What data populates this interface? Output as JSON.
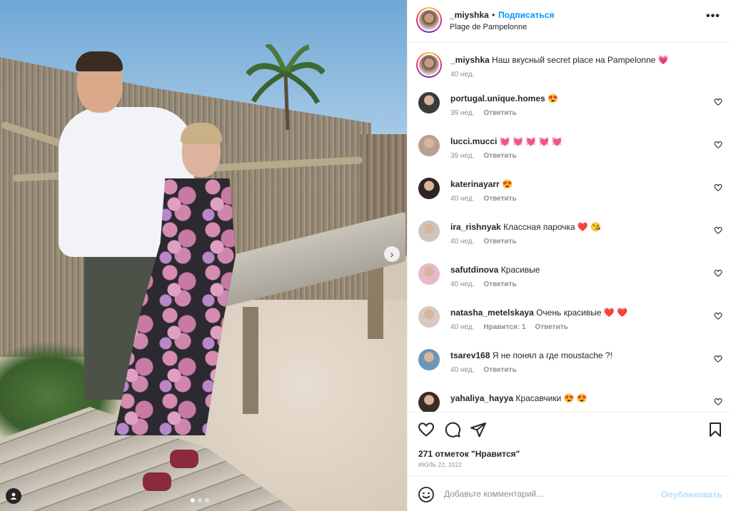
{
  "post": {
    "username": "_miyshka",
    "separator": "•",
    "follow_label": "Подписаться",
    "location": "Plage de Pampelonne",
    "more_label": "•••",
    "caption_text": "Наш вкусный secret place на Pampelonne",
    "caption_emoji": "💗",
    "caption_time": "40 нед."
  },
  "comments": [
    {
      "user": "portugal.unique.homes",
      "text": "",
      "emoji": "😍",
      "time": "39 нед.",
      "likes": "",
      "reply": "Ответить",
      "avatar_color": "#3a3a3a"
    },
    {
      "user": "lucci.mucci",
      "text": "",
      "emoji": "💓 💓 💓 💓 💓",
      "time": "39 нед.",
      "likes": "",
      "reply": "Ответить",
      "avatar_color": "#b9a08f"
    },
    {
      "user": "katerinayarr",
      "text": "",
      "emoji": "😍",
      "time": "40 нед.",
      "likes": "",
      "reply": "Ответить",
      "avatar_color": "#2e2522"
    },
    {
      "user": "ira_rishnyak",
      "text": "Классная парочка",
      "emoji": "❤️ 😘",
      "time": "40 нед.",
      "likes": "",
      "reply": "Ответить",
      "avatar_color": "#cfc5bb"
    },
    {
      "user": "safutdinova",
      "text": "Красивые",
      "emoji": "",
      "time": "40 нед.",
      "likes": "",
      "reply": "Ответить",
      "avatar_color": "#e8b9c9"
    },
    {
      "user": "natasha_metelskaya",
      "text": "Очень красивые",
      "emoji": "❤️ ❤️",
      "time": "40 нед.",
      "likes": "Нравится: 1",
      "reply": "Ответить",
      "avatar_color": "#d9c9c0"
    },
    {
      "user": "tsarev168",
      "text": "Я не понял а где moustache ?!",
      "emoji": "",
      "time": "40 нед.",
      "likes": "",
      "reply": "Ответить",
      "avatar_color": "#6d95b8"
    },
    {
      "user": "yahaliya_hayya",
      "text": "Красавчики",
      "emoji": "😍 😍",
      "time": "",
      "likes": "",
      "reply": "",
      "avatar_color": "#3b2d25"
    }
  ],
  "actions": {
    "likes_text": "271 отметок \"Нравится\"",
    "date": "ИЮЛЬ 22, 2022"
  },
  "add_comment": {
    "placeholder": "Добавьте комментарий...",
    "publish_label": "Опубликовать"
  },
  "colors": {
    "accent": "#0095f6",
    "publish_disabled": "#b2dffc",
    "muted": "#8e8e8e"
  },
  "icons": [
    "heart-icon",
    "comment-icon",
    "share-icon",
    "bookmark-icon",
    "more-icon",
    "emoji-icon",
    "chevron-right-icon",
    "user-tag-icon"
  ],
  "carousel": {
    "total_slides": 3,
    "active_slide": 1
  }
}
